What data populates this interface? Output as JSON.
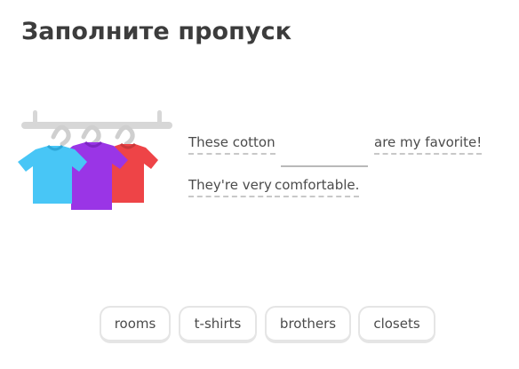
{
  "header": {
    "title": "Заполните пропуск"
  },
  "illustration": {
    "icon": "clothes-rack-shirts",
    "shirt_colors": [
      "#49c0f8",
      "#9b36e6",
      "#f2494b"
    ]
  },
  "sentence": {
    "part1": "These cotton",
    "part2": "are my favorite!",
    "part3_word1": "They're very",
    "part3_word2": "comfortable."
  },
  "choices": {
    "option1": "rooms",
    "option2": "t-shirts",
    "option3": "brothers",
    "option4": "closets"
  }
}
